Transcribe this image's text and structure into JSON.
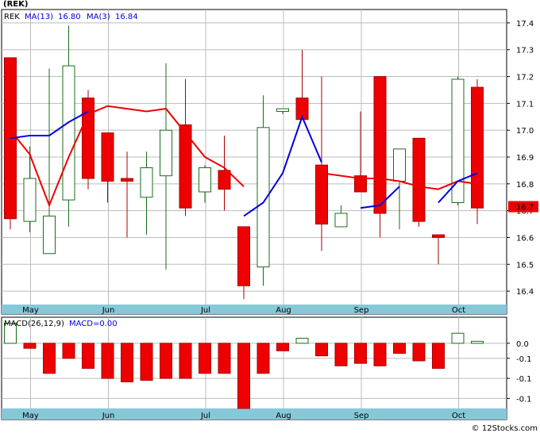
{
  "chart_data": [
    {
      "type": "candlestick",
      "legend": {
        "ticker_title": "(REK)",
        "ticker": "REK",
        "ma13_label": "MA(13)",
        "ma13_value": "16.80",
        "ma3_label": "MA(3)",
        "ma3_value": "16.84"
      },
      "ylim": [
        16.35,
        17.45
      ],
      "yticks": [
        "17.4",
        "17.3",
        "17.2",
        "17.1",
        "17.0",
        "16.9",
        "16.8",
        "16.7",
        "16.6",
        "16.5",
        "16.4"
      ],
      "last_price_label": "16.7",
      "last_price": 16.715,
      "months": [
        {
          "label": "May",
          "index": 1
        },
        {
          "label": "Jun",
          "index": 5
        },
        {
          "label": "Jul",
          "index": 10
        },
        {
          "label": "Aug",
          "index": 14
        },
        {
          "label": "Sep",
          "index": 18
        },
        {
          "label": "Oct",
          "index": 23
        }
      ],
      "candles": [
        {
          "open": 17.27,
          "close": 16.67,
          "high": 17.27,
          "low": 16.63
        },
        {
          "open": 16.66,
          "close": 16.82,
          "high": 16.94,
          "low": 16.62
        },
        {
          "open": 16.54,
          "close": 16.68,
          "high": 17.23,
          "low": 16.54
        },
        {
          "open": 16.74,
          "close": 17.24,
          "high": 17.39,
          "low": 16.64
        },
        {
          "open": 17.12,
          "close": 16.82,
          "high": 17.15,
          "low": 16.78
        },
        {
          "open": 16.99,
          "close": 16.81,
          "high": 16.99,
          "low": 16.73
        },
        {
          "open": 16.82,
          "close": 16.81,
          "high": 16.92,
          "low": 16.6
        },
        {
          "open": 16.75,
          "close": 16.86,
          "high": 16.92,
          "low": 16.61
        },
        {
          "open": 16.83,
          "close": 17.0,
          "high": 17.25,
          "low": 16.48
        },
        {
          "open": 17.02,
          "close": 16.71,
          "high": 17.19,
          "low": 16.68
        },
        {
          "open": 16.77,
          "close": 16.86,
          "high": 16.87,
          "low": 16.73
        },
        {
          "open": 16.85,
          "close": 16.78,
          "high": 16.98,
          "low": 16.7
        },
        {
          "open": 16.64,
          "close": 16.42,
          "high": 16.64,
          "low": 16.37
        },
        {
          "open": 16.49,
          "close": 17.01,
          "high": 17.13,
          "low": 16.42
        },
        {
          "open": 17.07,
          "close": 17.08,
          "high": 17.08,
          "low": 17.06
        },
        {
          "open": 17.12,
          "close": 17.04,
          "high": 17.3,
          "low": 17.04
        },
        {
          "open": 16.87,
          "close": 16.65,
          "high": 17.2,
          "low": 16.55
        },
        {
          "open": 16.64,
          "close": 16.69,
          "high": 16.72,
          "low": 16.64
        },
        {
          "open": 16.83,
          "close": 16.77,
          "high": 17.07,
          "low": 16.77
        },
        {
          "open": 17.2,
          "close": 16.69,
          "high": 17.2,
          "low": 16.6
        },
        {
          "open": 16.81,
          "close": 16.93,
          "high": 16.93,
          "low": 16.63
        },
        {
          "open": 16.97,
          "close": 16.66,
          "high": 16.97,
          "low": 16.64
        },
        {
          "open": 16.61,
          "close": 16.6,
          "high": 16.61,
          "low": 16.5
        },
        {
          "open": 16.73,
          "close": 17.19,
          "high": 17.2,
          "low": 16.72
        },
        {
          "open": 17.16,
          "close": 16.71,
          "high": 17.19,
          "low": 16.65
        }
      ],
      "ma13": [
        17.0,
        16.91,
        16.72,
        16.9,
        17.06,
        17.09,
        17.08,
        17.07,
        17.08,
        16.99,
        16.9,
        16.86,
        16.79,
        null,
        null,
        null,
        16.84,
        16.83,
        16.82,
        16.82,
        16.81,
        16.79,
        16.78,
        16.81,
        16.8
      ],
      "ma3": [
        16.97,
        16.98,
        16.98,
        17.03,
        17.07,
        null,
        null,
        null,
        null,
        null,
        null,
        null,
        16.68,
        16.73,
        16.84,
        17.05,
        16.88,
        null,
        16.71,
        16.72,
        16.79,
        null,
        16.73,
        16.81,
        16.84
      ]
    },
    {
      "type": "bar",
      "legend": {
        "macd_label": "MACD(26,12,9)",
        "macd_value_label": "MACD=0.00"
      },
      "ylim": [
        -0.13,
        0.052
      ],
      "yticks": [
        "0.0",
        "-0.1",
        "-0.1",
        "-0.1"
      ],
      "ytick_values": [
        0.0,
        -0.03,
        -0.07,
        -0.11
      ],
      "values": [
        0.04,
        -0.01,
        -0.06,
        -0.03,
        -0.05,
        -0.07,
        -0.077,
        -0.074,
        -0.07,
        -0.07,
        -0.06,
        -0.06,
        -0.13,
        -0.06,
        -0.015,
        0.01,
        -0.025,
        -0.045,
        -0.04,
        -0.045,
        -0.02,
        -0.035,
        -0.05,
        0.02,
        0.004
      ]
    }
  ],
  "footer": {
    "copyright": "© 12Stocks.com"
  },
  "colors": {
    "up_body": "#ffffff",
    "up_border": "#1a6e1a",
    "down_body": "#ee0000",
    "down_border": "#aa0000",
    "ma13": "#0000dd",
    "ma3": "#ee0000",
    "grid": "#bbbbbb",
    "axis_band": "#87c8d8",
    "last_price_box": "#ee0000",
    "macd_pos": "#ffffff",
    "macd_neg": "#ee0000"
  }
}
